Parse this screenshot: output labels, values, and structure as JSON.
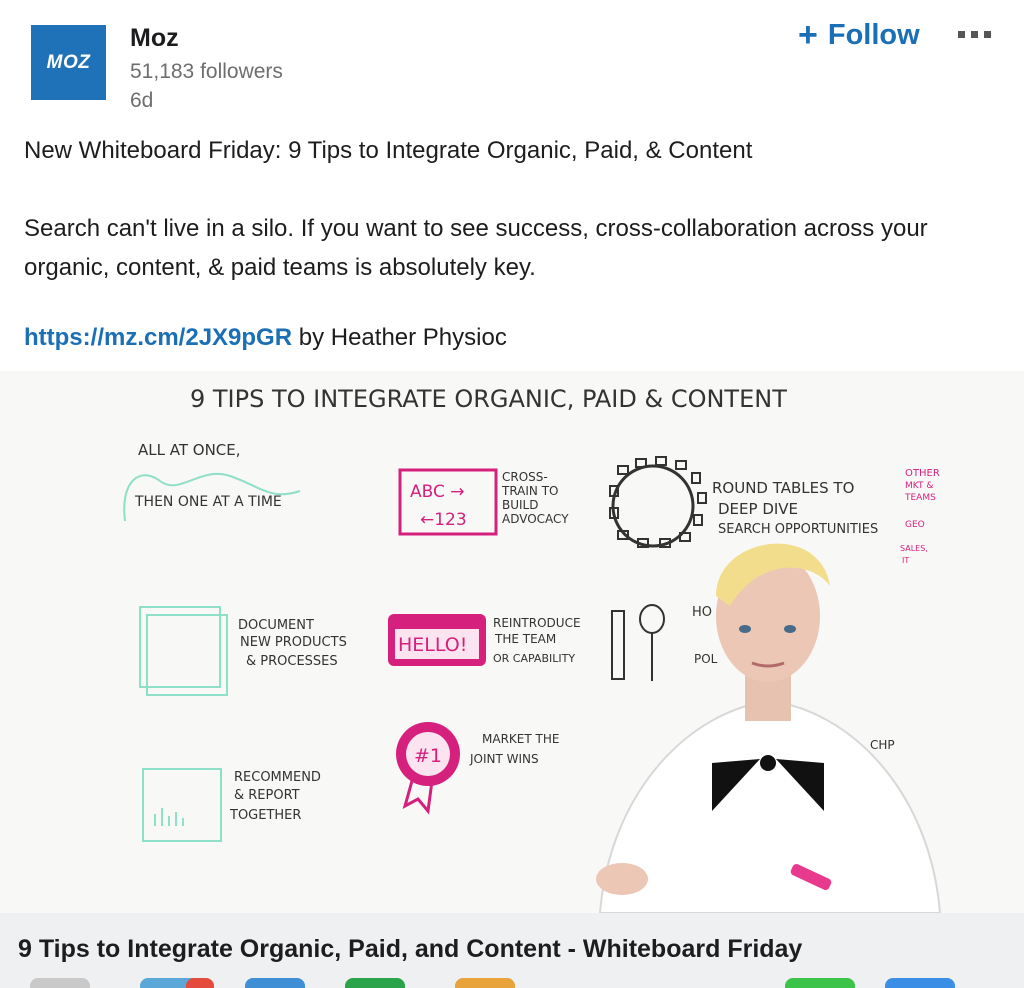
{
  "author": {
    "avatar_text": "MOZ",
    "name": "Moz",
    "followers": "51,183 followers",
    "time": "6d"
  },
  "actions": {
    "follow_label": "Follow",
    "follow_plus": "+"
  },
  "post": {
    "title": "New Whiteboard Friday: 9 Tips to Integrate Organic, Paid, & Content",
    "body": "Search can't live in a silo. If you want to see success, cross-collaboration across your organic, content, & paid teams is absolutely key.",
    "link": "https://mz.cm/2JX9pGR",
    "link_suffix": " by Heather Physioc"
  },
  "whiteboard": {
    "heading": "9  TIPS TO  INTEGRATE ORGANIC, PAID & CONTENT",
    "tip1a": "ALL AT ONCE,",
    "tip1b": "THEN ONE AT A TIME",
    "tip2_box_top": "ABC →",
    "tip2_box_bottom": "←123",
    "tip2_l1": "CROSS-",
    "tip2_l2": "TRAIN TO",
    "tip2_l3": "BUILD",
    "tip2_l4": "ADVOCACY",
    "tip3_l1": "ROUND TABLES TO",
    "tip3_l2": "DEEP DIVE",
    "tip3_l3": "SEARCH OPPORTUNITIES",
    "tip3_side1": "OTHER",
    "tip3_side2": "MKT &",
    "tip3_side3": "TEAMS",
    "tip3_side4": "GEO",
    "tip3_side5": "SALES,",
    "tip3_side6": "IT",
    "tip4_l1": "DOCUMENT",
    "tip4_l2": "NEW PRODUCTS",
    "tip4_l3": "& PROCESSES",
    "tip5_badge": "HELLO!",
    "tip5_l1": "REINTRODUCE",
    "tip5_l2": "THE TEAM",
    "tip5_l3": "OR CAPABILITY",
    "tip6_l1": "HO",
    "tip6_l2": "POL",
    "tip7_ribbon": "#1",
    "tip7_l1": "MARKET THE",
    "tip7_l2": "JOINT WINS",
    "tip8_l1": "RECOMMEND",
    "tip8_l2": "& REPORT",
    "tip8_l3": "TOGETHER",
    "tip9_fragment": "CHP"
  },
  "caption": "9 Tips to Integrate Organic, Paid, and Content - Whiteboard Friday",
  "colors": {
    "brand_blue": "#1f72b8",
    "link_blue": "#1a6fb5",
    "magenta": "#d6207e",
    "teal": "#5fd3b3"
  },
  "icons": [
    "more-icon",
    "plus-icon"
  ]
}
